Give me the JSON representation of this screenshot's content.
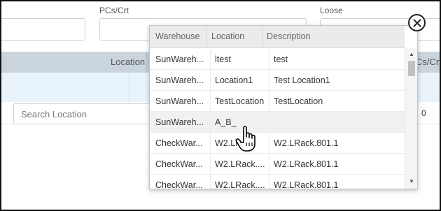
{
  "form": {
    "pcs_label": "PCs/Crt",
    "loose_label": "Loose"
  },
  "grid": {
    "header_location": "Location",
    "header_pcs": "Cs/Crt",
    "search_location_placeholder": "Search Location",
    "row_value": "0"
  },
  "dropdown": {
    "columns": [
      "Warehouse",
      "Location",
      "Description"
    ],
    "rows": [
      {
        "warehouse": "SunWareh...",
        "location": "ltest",
        "description": "test"
      },
      {
        "warehouse": "SunWareh...",
        "location": "Location1",
        "description": "Test Location1"
      },
      {
        "warehouse": "SunWareh...",
        "location": "TestLocation",
        "description": "TestLocation"
      },
      {
        "warehouse": "SunWareh...",
        "location": "A_B_",
        "description": ""
      },
      {
        "warehouse": "CheckWar...",
        "location": "W2.LR...",
        "description": "W2.LRack.801.1"
      },
      {
        "warehouse": "CheckWar...",
        "location": "W2.LRack....",
        "description": "W2.LRack.801.1"
      },
      {
        "warehouse": "CheckWar...",
        "location": "W2.LRack....",
        "description": "W2.LRack.801.1"
      }
    ],
    "hover_row_index": 3
  },
  "icons": {
    "close": "close-icon",
    "scroll_up": "triangle-up-icon",
    "scroll_down": "triangle-down-icon",
    "cursor": "hand-pointer-icon"
  }
}
